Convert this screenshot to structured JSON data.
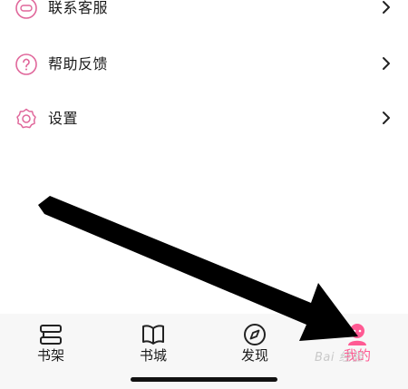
{
  "menu": {
    "items": [
      {
        "label": "联系客服",
        "icon": "headset-icon"
      },
      {
        "label": "帮助反馈",
        "icon": "help-icon"
      },
      {
        "label": "设置",
        "icon": "settings-icon"
      }
    ]
  },
  "tabbar": {
    "tabs": [
      {
        "label": "书架",
        "icon": "bookshelf-icon",
        "active": false
      },
      {
        "label": "书城",
        "icon": "book-icon",
        "active": false
      },
      {
        "label": "发现",
        "icon": "compass-icon",
        "active": false
      },
      {
        "label": "我的",
        "icon": "profile-icon",
        "active": true
      }
    ]
  },
  "watermark": {
    "text": "Bai 经验"
  },
  "colors": {
    "accent": "#ff5a93",
    "icon_stroke": "#e0679b",
    "tabbar_bg": "#f7f7f7"
  }
}
